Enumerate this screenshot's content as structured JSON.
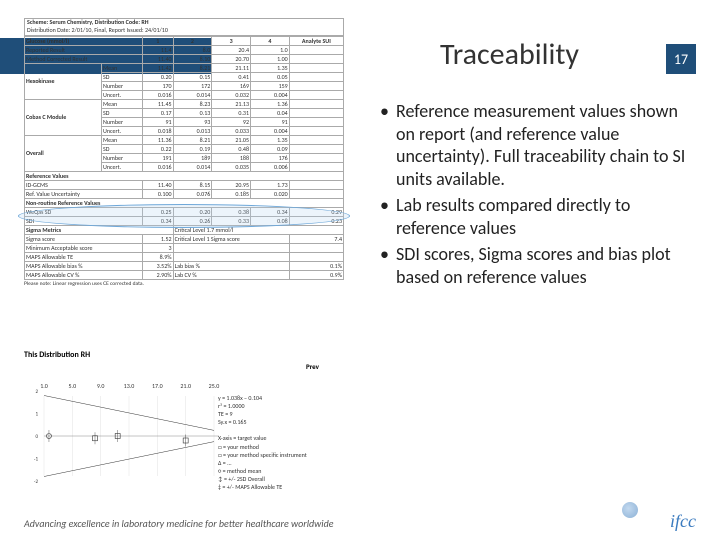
{
  "slide": {
    "title": "Traceability",
    "page_number": "17",
    "bullets": [
      "Reference measurement values shown on report (and reference value uncertainty).  Full traceability chain to SI units available.",
      "Lab results compared directly to reference values",
      "SDI scores, Sigma scores and bias plot based on reference values"
    ],
    "footer": "Advancing excellence in laboratory medicine for better healthcare worldwide",
    "logo": "ifcc"
  },
  "report": {
    "scheme": "Scheme: Serum Chemistry, Distribution Code: RH",
    "dist": "Distribution Date: 2/01/10, Final, Report Issued: 24/01/10",
    "analyte": "Glucose (mmol/l)",
    "col_headers": [
      "1",
      "2",
      "3",
      "4",
      "Analyte SUI"
    ],
    "reported": [
      "Reported Result",
      "11.4",
      "8.0",
      "20.4",
      "1.0"
    ],
    "method_corrected": [
      "Method Corrected Result",
      "11.40",
      "8.10",
      "20.70",
      "1.00"
    ],
    "sections": [
      {
        "name": "Hexokinase",
        "rows": [
          [
            "Mean",
            "11.42",
            "8.21",
            "21.11",
            "1.35"
          ],
          [
            "SD",
            "0.20",
            "0.15",
            "0.41",
            "0.05"
          ],
          [
            "Number",
            "170",
            "172",
            "169",
            "159"
          ],
          [
            "Uncert.",
            "0.016",
            "0.014",
            "0.032",
            "0.004"
          ]
        ]
      },
      {
        "name": "Cobas C Module",
        "rows": [
          [
            "Mean",
            "11.45",
            "8.23",
            "21.13",
            "1.36"
          ],
          [
            "SD",
            "0.17",
            "0.13",
            "0.31",
            "0.04"
          ],
          [
            "Number",
            "91",
            "93",
            "92",
            "91"
          ],
          [
            "Uncert.",
            "0.018",
            "0.013",
            "0.033",
            "0.004"
          ]
        ]
      },
      {
        "name": "Overall",
        "rows": [
          [
            "Mean",
            "11.36",
            "8.21",
            "21.05",
            "1.35"
          ],
          [
            "SD",
            "0.22",
            "0.19",
            "0.48",
            "0.09"
          ],
          [
            "Number",
            "191",
            "189",
            "188",
            "176"
          ],
          [
            "Uncert.",
            "0.016",
            "0.014",
            "0.035",
            "0.006"
          ]
        ]
      }
    ],
    "ref_values_label": "Reference Values",
    "ref_row": [
      "ID-GCMS",
      "11.40",
      "8.15",
      "20.95",
      "1.73"
    ],
    "ref_uncert": [
      "Ref. Value Uncertainty",
      "0.100",
      "0.076",
      "0.185",
      "0.020"
    ],
    "non_routing_label": "Non-routine Reference Values",
    "wegas": [
      "WeQas SD",
      "0.25",
      "0.20",
      "0.38",
      "0.34",
      "0.29"
    ],
    "sdi": [
      "SDI",
      "0.34",
      "0.26",
      "0.33",
      "0.08",
      "0.23"
    ],
    "sigma_header": "Sigma Metrics",
    "critical": "Critical Level 1.7 mmol/l",
    "sigma_rows": [
      [
        "Sigma score",
        "1.52",
        "Critical Level 1 Sigma score",
        "7.4"
      ],
      [
        "Minimum Acceptable score",
        "3",
        "",
        " "
      ],
      [
        "MAPS Allowable TE",
        "8.9%",
        "",
        ""
      ],
      [
        "MAPS Allowable bias %",
        "3.52%",
        "Lab bias %",
        "0.1%"
      ],
      [
        "MAPS Allowable CV %",
        "2.90%",
        "Lab CV %",
        "0.9%"
      ]
    ],
    "note": "Please note: Linear regression uses CE corrected data."
  },
  "chart_data": {
    "type": "scatter",
    "title": "This Distribution RH",
    "right_label": "Prev",
    "xlabel": "",
    "ylabel": "",
    "x_ticks": [
      1.0,
      5.0,
      9.0,
      13.0,
      17.0,
      21.0,
      25.0
    ],
    "ylim": [
      -2,
      2
    ],
    "funnel_upper": [
      [
        1.0,
        1.8
      ],
      [
        25.0,
        0.25
      ]
    ],
    "funnel_lower": [
      [
        1.0,
        -1.8
      ],
      [
        25.0,
        -0.25
      ]
    ],
    "points": [
      {
        "x": 1.7,
        "y": 0.0,
        "marker": "circle"
      },
      {
        "x": 8.2,
        "y": -0.1,
        "marker": "square"
      },
      {
        "x": 11.4,
        "y": 0.0,
        "marker": "square"
      },
      {
        "x": 21.0,
        "y": -0.2,
        "marker": "square"
      }
    ],
    "legend": [
      "y = 1.038x − 0.104",
      "r² = 1.0000",
      "TE = 9",
      "Sy.x = 0.165",
      "",
      "X-axis = target value",
      "□ = your method",
      "□ = your method specific instrument",
      "Δ = ...",
      "○ = method mean",
      "↕ = +/- 2SD Overall",
      "‡ = +/- MAPS Allowable TE"
    ]
  }
}
